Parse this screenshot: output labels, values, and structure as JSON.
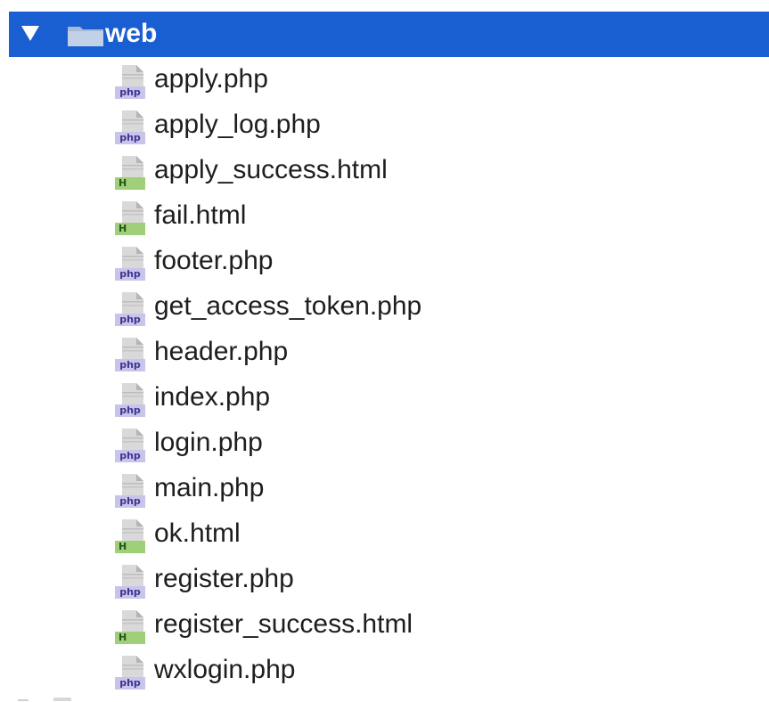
{
  "colors": {
    "selection": "#1a5fd1"
  },
  "folder": {
    "disclosure_icon": "triangle-down-icon",
    "icon": "folder-icon",
    "name": "web",
    "expanded": true,
    "selected": true
  },
  "files": [
    {
      "name": "apply.php",
      "type": "php",
      "tag": "php"
    },
    {
      "name": "apply_log.php",
      "type": "php",
      "tag": "php"
    },
    {
      "name": "apply_success.html",
      "type": "html",
      "tag": "H"
    },
    {
      "name": "fail.html",
      "type": "html",
      "tag": "H"
    },
    {
      "name": "footer.php",
      "type": "php",
      "tag": "php"
    },
    {
      "name": "get_access_token.php",
      "type": "php",
      "tag": "php"
    },
    {
      "name": "header.php",
      "type": "php",
      "tag": "php"
    },
    {
      "name": "index.php",
      "type": "php",
      "tag": "php"
    },
    {
      "name": "login.php",
      "type": "php",
      "tag": "php"
    },
    {
      "name": "main.php",
      "type": "php",
      "tag": "php"
    },
    {
      "name": "ok.html",
      "type": "html",
      "tag": "H"
    },
    {
      "name": "register.php",
      "type": "php",
      "tag": "php"
    },
    {
      "name": "register_success.html",
      "type": "html",
      "tag": "H"
    },
    {
      "name": "wxlogin.php",
      "type": "php",
      "tag": "php"
    }
  ]
}
